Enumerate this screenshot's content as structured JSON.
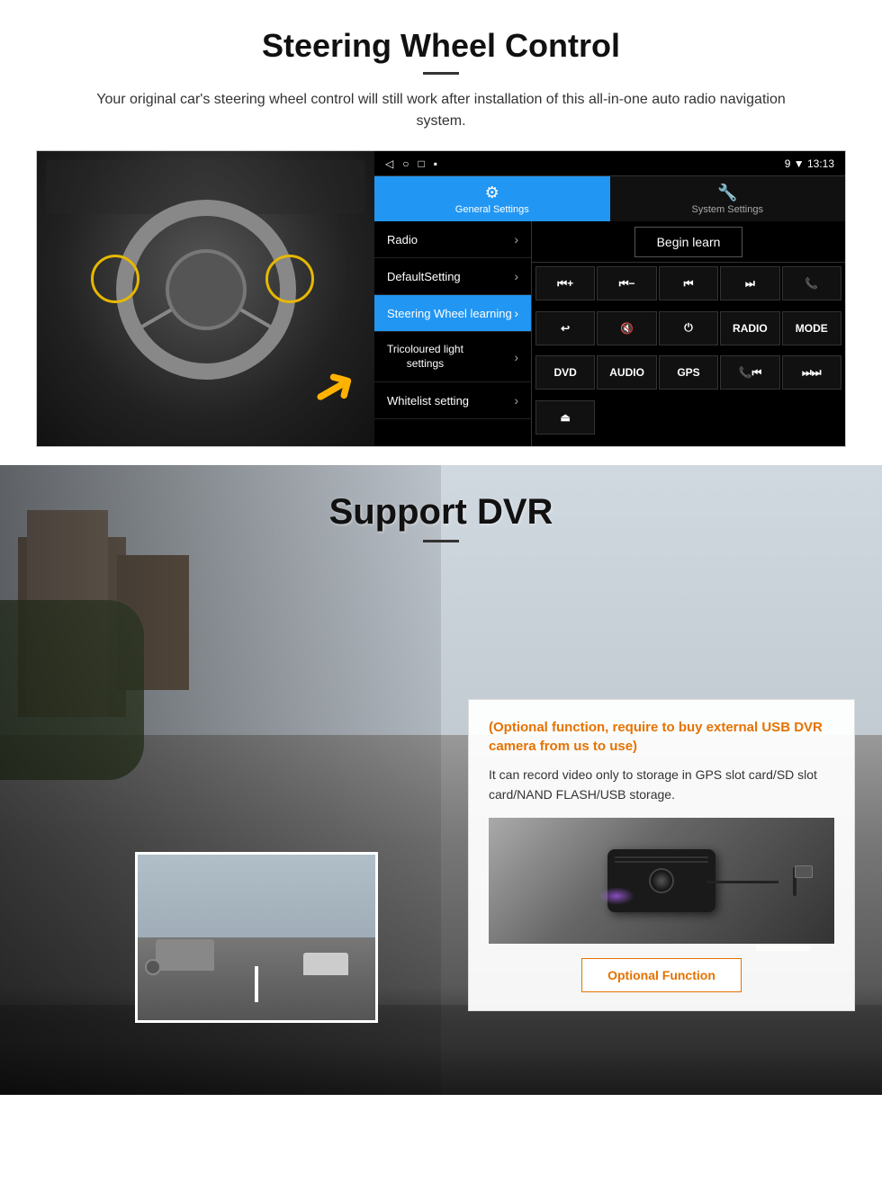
{
  "page": {
    "section1": {
      "title": "Steering Wheel Control",
      "subtitle": "Your original car's steering wheel control will still work after installation of this all-in-one auto radio navigation system.",
      "android_ui": {
        "status_bar": {
          "left_icons": "◁  ○  □  ▪",
          "right_info": "9 ▼ 13:13"
        },
        "tabs": [
          {
            "icon": "⚙",
            "label": "General Settings",
            "active": true
          },
          {
            "icon": "🔧",
            "label": "System Settings",
            "active": false
          }
        ],
        "menu_items": [
          {
            "label": "Radio",
            "active": false
          },
          {
            "label": "DefaultSetting",
            "active": false
          },
          {
            "label": "Steering Wheel learning",
            "active": true
          },
          {
            "label": "Tricoloured light settings",
            "active": false
          },
          {
            "label": "Whitelist setting",
            "active": false
          }
        ],
        "begin_learn": "Begin learn",
        "control_buttons": [
          "⏮+",
          "⏮−",
          "⏮⏮",
          "⏭⏭",
          "📞",
          "↩",
          "🔇",
          "⏻",
          "RADIO",
          "MODE",
          "DVD",
          "AUDIO",
          "GPS",
          "📞⏮",
          "⏭⏭"
        ],
        "last_row_btn": "⏏"
      }
    },
    "section2": {
      "title": "Support DVR",
      "optional_text": "(Optional function, require to buy external USB DVR camera from us to use)",
      "description": "It can record video only to storage in GPS slot card/SD slot card/NAND FLASH/USB storage.",
      "optional_btn_label": "Optional Function"
    }
  }
}
